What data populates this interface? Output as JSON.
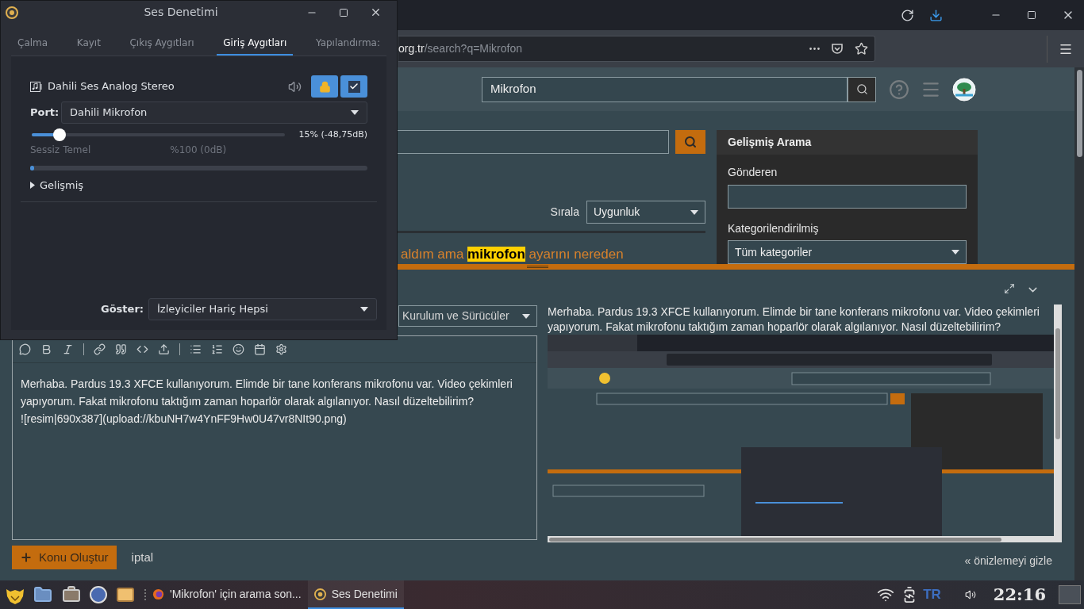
{
  "dialog": {
    "title": "Ses Denetimi",
    "tabs": [
      {
        "label": "Çalma",
        "selected": false
      },
      {
        "label": "Kayıt",
        "selected": false
      },
      {
        "label": "Çıkış Aygıtları",
        "selected": false
      },
      {
        "label": "Giriş Aygıtları",
        "selected": true
      },
      {
        "label": "Yapılandırma:",
        "selected": false
      }
    ],
    "device": {
      "name": "Dahili Ses Analog Stereo",
      "lock_on": true,
      "default_on": true
    },
    "port": {
      "label": "Port:",
      "value": "Dahili Mikrofon"
    },
    "volume": {
      "level": 0.11,
      "reading": "15% (-48,75dB)",
      "tick_labels": [
        "Sessiz",
        "Temel",
        "%100 (0dB)"
      ]
    },
    "meter": {
      "level": 0.01
    },
    "advanced": {
      "label": "Gelişmiş",
      "expanded": false
    },
    "show": {
      "label": "Göster:",
      "value": "İzleyiciler Hariç Hepsi"
    }
  },
  "browser": {
    "address": {
      "host": "org.tr",
      "path": "/search?q=Mikrofon"
    },
    "header_search": {
      "value": "Mikrofon"
    },
    "sort": {
      "label": "Sırala",
      "value": "Uygunluk"
    },
    "result": {
      "before": "aldım ama ",
      "highlight": "mikrofon",
      "after": " ayarını nereden"
    },
    "advanced_search": {
      "title": "Gelişmiş Arama",
      "sender_label": "Gönderen",
      "category_label": "Kategorilendirilmiş",
      "category": "Tüm kategoriler"
    },
    "composer": {
      "category": "Kurulum ve Sürücüler",
      "body": "Merhaba. Pardus 19.3 XFCE kullanıyorum. Elimde bir tane konferans mikrofonu var. Video çekimleri yapıyorum. Fakat mikrofonu taktığım zaman hoparlör olarak algılanıyor. Nasıl düzeltebilirim?\n![resim|690x387](upload://kbuNH7w4YnFF9Hw0U47vr8NIt90.png)",
      "preview": "Merhaba. Pardus 19.3 XFCE kullanıyorum. Elimde bir tane konferans mikrofonu var. Video çekimleri yapıyorum. Fakat mikrofonu taktığım zaman hoparlör olarak algılanıyor. Nasıl düzeltebilirim?",
      "create_button": "Konu Oluştur",
      "cancel": "iptal",
      "hide_preview": "« önizlemeyi gizle"
    }
  },
  "taskbar": {
    "windows": [
      {
        "kind": "browser",
        "label": "'Mikrofon' için arama son...",
        "selected": false
      },
      {
        "kind": "sound",
        "label": "Ses Denetimi",
        "selected": true
      }
    ],
    "language": "TR",
    "clock": "22:16"
  }
}
